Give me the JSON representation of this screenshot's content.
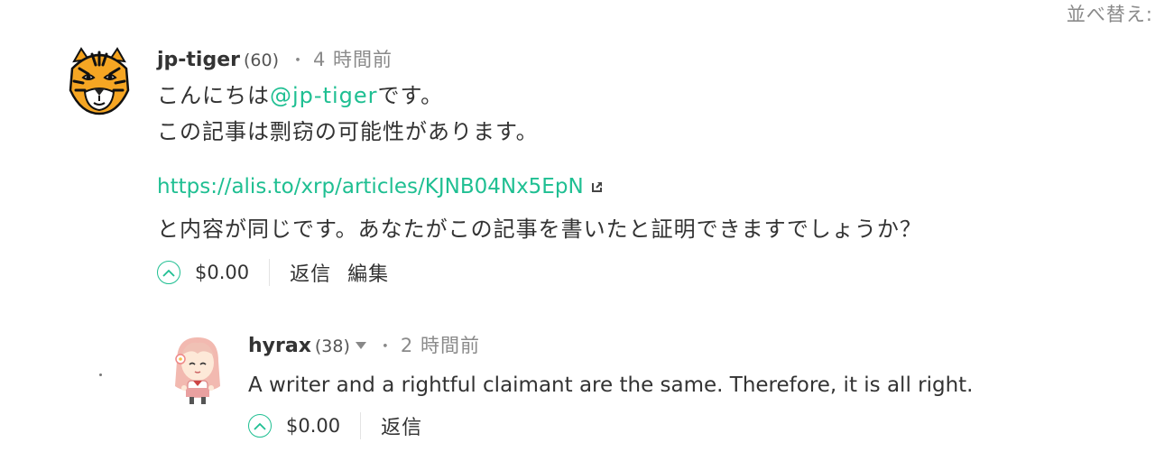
{
  "sort": {
    "label": "並べ替え:"
  },
  "comments": [
    {
      "username": "jp-tiger",
      "score": "(60)",
      "separator": "・",
      "time": "4 時間前",
      "line1_prefix": "こんにちは",
      "mention": "@jp-tiger",
      "line1_suffix": "です。",
      "line2": "この記事は剽窃の可能性があります。",
      "link": "https://alis.to/xrp/articles/KJNB04Nx5EpN",
      "line3": "と内容が同じです。あなたがこの記事を書いたと証明できますでしょうか？",
      "amount": "$0.00",
      "reply_label": "返信",
      "edit_label": "編集"
    },
    {
      "username": "hyrax",
      "score": "(38)",
      "separator": "・",
      "time": "2 時間前",
      "text": "A writer and a rightful claimant are the same. Therefore, it is all right.",
      "amount": "$0.00",
      "reply_label": "返信"
    }
  ],
  "colors": {
    "accent": "#1fbf92",
    "muted": "#8a8a8a",
    "text": "#333333"
  }
}
